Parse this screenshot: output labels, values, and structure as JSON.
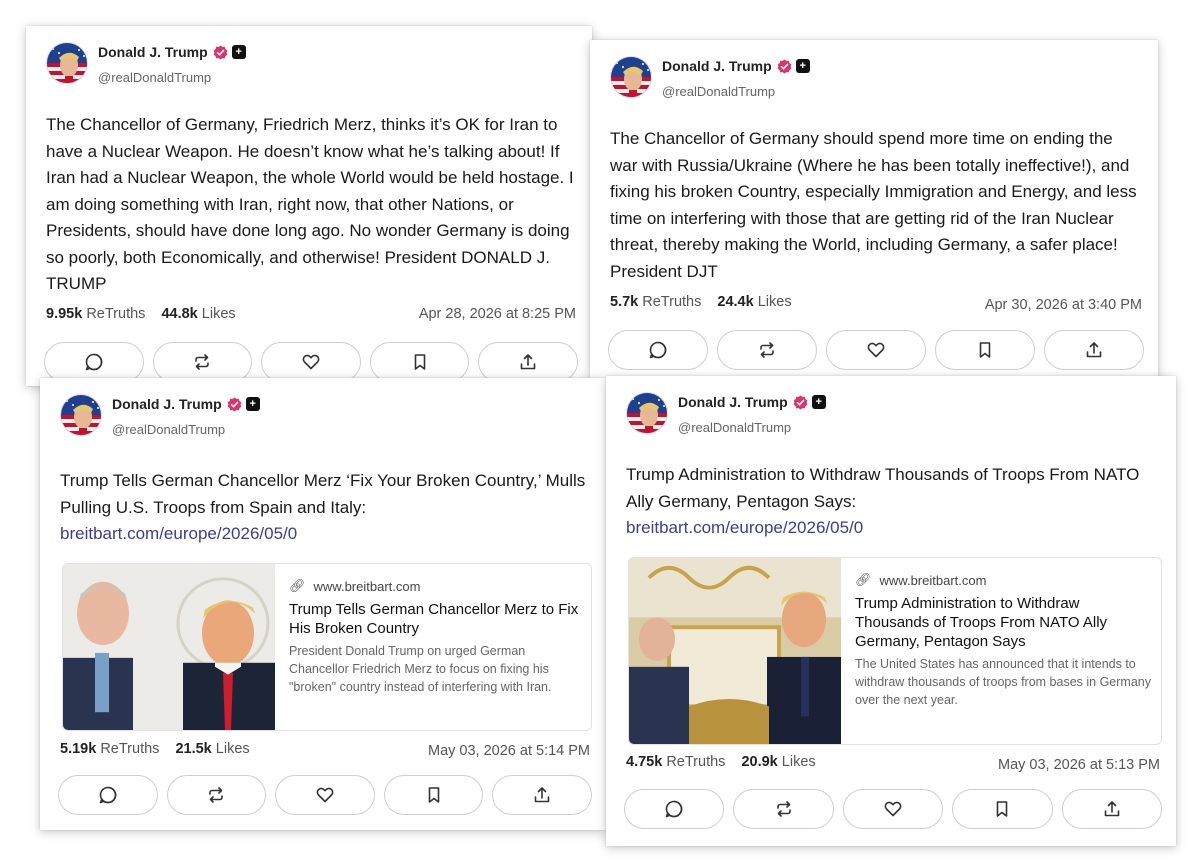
{
  "author": {
    "display_name": "Donald J. Trump",
    "handle": "@realDonaldTrump",
    "verified_icon": "verified-check-badge",
    "plus_icon": "plus-badge"
  },
  "posts": [
    {
      "text": "The Chancellor of Germany, Friedrich Merz, thinks it’s OK for Iran to have a Nuclear Weapon. He doesn’t know what he’s talking about! If Iran had a Nuclear Weapon, the whole World would be held hostage. I am doing something with Iran, right now, that other Nations, or Presidents, should have done long ago. No wonder Germany is doing so poorly, both Economically, and otherwise! President DONALD J. TRUMP",
      "retruths": "9.95k",
      "likes": "44.8k",
      "date": "Apr 28, 2026 at 8:25 PM"
    },
    {
      "text": "The Chancellor of Germany should spend more time on ending the war with Russia/Ukraine (Where he has been totally ineffective!), and fixing his broken Country, especially Immigration and Energy, and less time on interfering with those that are getting rid of the Iran Nuclear threat, thereby making the World, including Germany, a safer place! President DJT",
      "retruths": "5.7k",
      "likes": "24.4k",
      "date": "Apr 30, 2026 at 3:40 PM"
    },
    {
      "text": "Trump Tells German Chancellor Merz ‘Fix Your Broken Country,’ Mulls Pulling U.S. Troops from Spain and Italy:",
      "link": "breitbart.com/europe/2026/05/0",
      "card": {
        "domain": "www.breitbart.com",
        "title": "Trump Tells German Chancellor Merz to Fix His Broken Country",
        "description": "President Donald Trump on urged German Chancellor Friedrich Merz to focus on fixing his \"broken\" country instead of interfering with Iran."
      },
      "retruths": "5.19k",
      "likes": "21.5k",
      "date": "May 03, 2026 at 5:14 PM"
    },
    {
      "text": "Trump Administration to Withdraw Thousands of Troops From NATO Ally Germany, Pentagon Says:",
      "link": "breitbart.com/europe/2026/05/0",
      "card": {
        "domain": "www.breitbart.com",
        "title": "Trump Administration to Withdraw Thousands of Troops From NATO Ally Germany, Pentagon Says",
        "description": "The United States has announced that it intends to withdraw thousands of troops from bases in Germany over the next year."
      },
      "retruths": "4.75k",
      "likes": "20.9k",
      "date": "May 03, 2026 at 5:13 PM"
    }
  ],
  "labels": {
    "retruths": "ReTruths",
    "likes": "Likes"
  },
  "action_icons": [
    "reply-icon",
    "retruth-icon",
    "like-icon",
    "bookmark-icon",
    "share-icon"
  ],
  "colors": {
    "verified": "#e0306e",
    "link": "#3b3b9e"
  }
}
